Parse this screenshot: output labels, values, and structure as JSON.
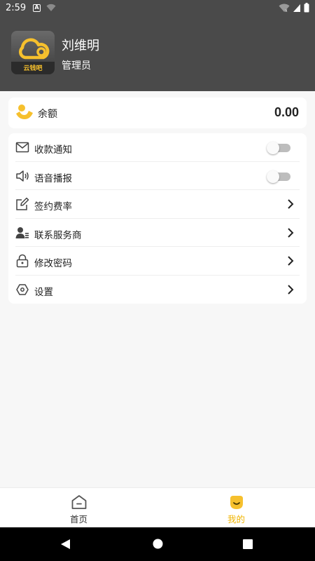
{
  "status_bar": {
    "time": "2:59",
    "a_badge": "A"
  },
  "profile": {
    "name": "刘维明",
    "role": "管理员",
    "logo_text": "云钱吧"
  },
  "balance": {
    "label": "余额",
    "value": "0.00"
  },
  "menu": {
    "items": [
      {
        "label": "收款通知",
        "icon": "mail-icon",
        "type": "toggle",
        "enabled": false
      },
      {
        "label": "语音播报",
        "icon": "speaker-icon",
        "type": "toggle",
        "enabled": false
      },
      {
        "label": "签约费率",
        "icon": "edit-icon",
        "type": "link"
      },
      {
        "label": "联系服务商",
        "icon": "contact-icon",
        "type": "link"
      },
      {
        "label": "修改密码",
        "icon": "lock-icon",
        "type": "link"
      },
      {
        "label": "设置",
        "icon": "settings-icon",
        "type": "link"
      }
    ]
  },
  "bottom_nav": {
    "home_label": "首页",
    "mine_label": "我的",
    "active": "mine"
  },
  "colors": {
    "accent": "#f6c02d",
    "header": "#4a4a4a"
  }
}
